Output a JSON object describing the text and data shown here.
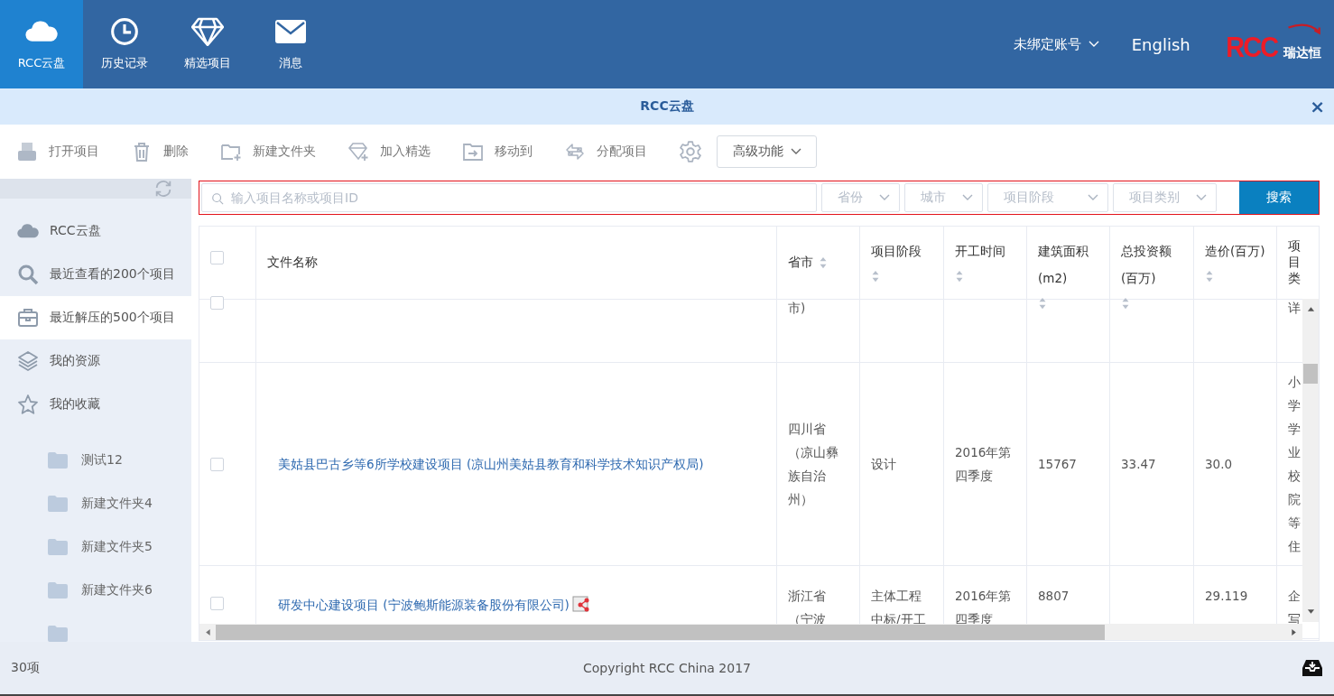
{
  "nav": {
    "tabs": [
      {
        "label": "RCC云盘",
        "kind": "cloud",
        "selected": true
      },
      {
        "label": "历史记录",
        "kind": "clock",
        "selected": false
      },
      {
        "label": "精选项目",
        "kind": "diamond",
        "selected": false
      },
      {
        "label": "消息",
        "kind": "mail",
        "selected": false
      }
    ],
    "account": "未绑定账号",
    "language": "English",
    "logo": {
      "mark": "RCC",
      "text": "瑞达恒"
    }
  },
  "panel": {
    "title": "RCC云盘",
    "close": "×"
  },
  "toolbar": {
    "actions": [
      {
        "label": "打开项目",
        "kind": "printer"
      },
      {
        "label": "删除",
        "kind": "trash"
      },
      {
        "label": "新建文件夹",
        "kind": "folder-plus"
      },
      {
        "label": "加入精选",
        "kind": "diamond-plus"
      },
      {
        "label": "移动到",
        "kind": "folder-arrow"
      },
      {
        "label": "分配项目",
        "kind": "swap"
      }
    ],
    "advanced": "高级功能"
  },
  "filters": {
    "placeholder": "输入项目名称或项目ID",
    "dropdowns": [
      "省份",
      "城市",
      "项目阶段",
      "项目类别"
    ],
    "search_button": "搜索"
  },
  "sidebar": {
    "items": [
      {
        "label": "RCC云盘",
        "kind": "cloud",
        "selected": false
      },
      {
        "label": "最近查看的200个项目",
        "kind": "search",
        "selected": false
      },
      {
        "label": "最近解压的500个项目",
        "kind": "briefcase",
        "selected": true
      },
      {
        "label": "我的资源",
        "kind": "layers",
        "selected": false
      },
      {
        "label": "我的收藏",
        "kind": "star",
        "selected": false
      }
    ],
    "folders": [
      "测试12",
      "新建文件夹4",
      "新建文件夹5",
      "新建文件夹6"
    ]
  },
  "table": {
    "all_checked": false,
    "columns": [
      {
        "label": "文件名称",
        "sortable": false
      },
      {
        "label": "省市",
        "sortable": true
      },
      {
        "label": "项目阶段",
        "sortable": true
      },
      {
        "label": "开工时间",
        "sortable": true
      },
      {
        "label": "建筑面积 (m2)",
        "sortable": true
      },
      {
        "label": "总投资额 (百万)",
        "sortable": true
      },
      {
        "label": "造价(百万)",
        "sortable": true
      },
      {
        "label": "项目类",
        "sortable": false
      }
    ],
    "rows": [
      {
        "checked": false,
        "shared": false,
        "cells": [
          "",
          "市)",
          "",
          "",
          "",
          "",
          "",
          "详"
        ]
      },
      {
        "checked": false,
        "shared": false,
        "cells": [
          "美姑县巴古乡等6所学校建设项目 (凉山州美姑县教育和科学技术知识产权局)",
          "四川省（凉山彝族自治州）",
          "设计",
          "2016年第四季度",
          "15767",
          "33.47",
          "30.0",
          "小学学业校院等住"
        ]
      },
      {
        "checked": false,
        "shared": true,
        "cells": [
          "研发中心建设项目 (宁波鲍斯能源装备股份有限公司)",
          "浙江省（宁波",
          "主体工程中标/开工",
          "2016年第四季度",
          "8807",
          "",
          "29.119",
          "企写"
        ]
      }
    ]
  },
  "status_bar": {
    "count": "30项",
    "copyright": "Copyright RCC China 2017"
  }
}
